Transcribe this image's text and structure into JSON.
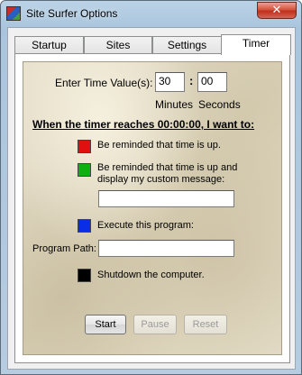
{
  "window": {
    "title": "Site Surfer Options",
    "close_label": "✕"
  },
  "tabs": [
    {
      "label": "Startup"
    },
    {
      "label": "Sites"
    },
    {
      "label": "Settings"
    },
    {
      "label": "Timer"
    }
  ],
  "timer": {
    "enter_label": "Enter Time Value(s):",
    "minutes_value": "30",
    "separator": ":",
    "seconds_value": "00",
    "minutes_label": "Minutes",
    "seconds_label": "Seconds",
    "heading": "When the timer reaches 00:00:00,  I want to:",
    "options": {
      "remind": {
        "label": "Be reminded that time is up.",
        "color": "#e01010"
      },
      "remind_custom": {
        "label_line1": "Be reminded that time is up and",
        "label_line2": "display my custom message:",
        "color": "#10b010",
        "message_value": ""
      },
      "execute": {
        "label": "Execute this program:",
        "color": "#0a2ee8"
      },
      "program_path": {
        "label": "Program Path:",
        "value": ""
      },
      "shutdown": {
        "label": "Shutdown the computer.",
        "color": "#000000"
      }
    },
    "buttons": {
      "start": "Start",
      "pause": "Pause",
      "reset": "Reset"
    }
  }
}
